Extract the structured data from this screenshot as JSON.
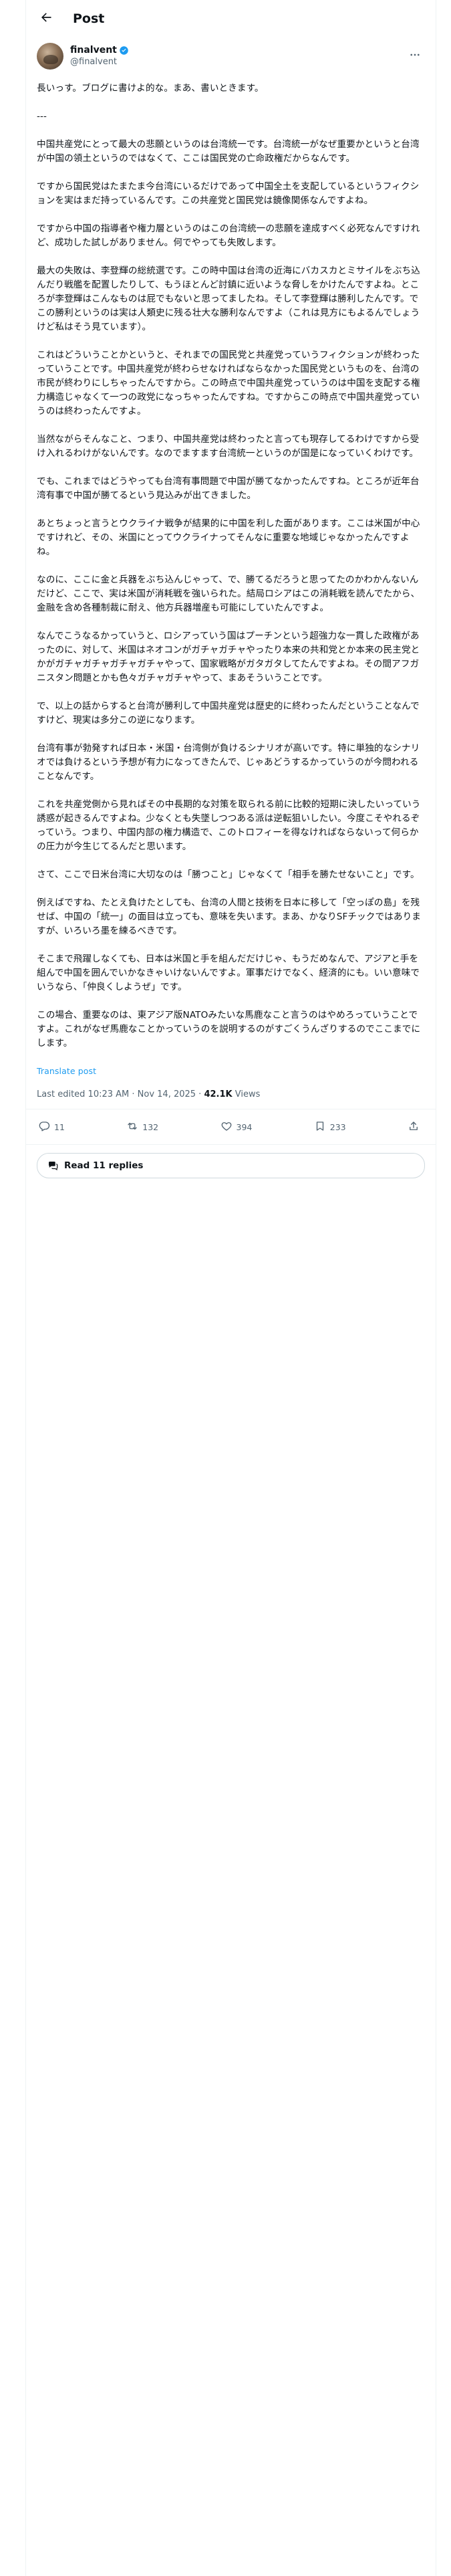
{
  "header": {
    "title": "Post"
  },
  "author": {
    "display_name": "finalvent",
    "handle": "@finalvent"
  },
  "post": {
    "paragraphs": [
      "長いっす。ブログに書けよ的な。まあ、書いときます。",
      "---",
      "中国共産党にとって最大の悲願というのは台湾統一です。台湾統一がなぜ重要かというと台湾が中国の領土というのではなくて、ここは国民党の亡命政権だからなんです。",
      "ですから国民党はたまたま今台湾にいるだけであって中国全土を支配しているというフィクションを実はまだ持っているんです。この共産党と国民党は鏡像関係なんですよね。",
      "ですから中国の指導者や権力層というのはこの台湾統一の悲願を達成すべく必死なんですけれど、成功した試しがありません。何でやっても失敗します。",
      "最大の失敗は、李登輝の総統選です。この時中国は台湾の近海にバカスカとミサイルをぶち込んだり戦艦を配置したりして、もうほとんど討鎮に近いような脅しをかけたんですよね。ところが李登輝はこんなものは屁でもないと思ってましたね。そして李登輝は勝利したんです。でこの勝利というのは実は人類史に残る壮大な勝利なんですよ（これは見方にもよるんでしょうけど私はそう見ています）。",
      "これはどういうことかというと、それまでの国民党と共産党っていうフィクションが終わったっていうことです。中国共産党が終わらせなければならなかった国民党というものを、台湾の市民が終わりにしちゃったんですから。この時点で中国共産党っていうのは中国を支配する権力構造じゃなくて一つの政党になっちゃったんですね。ですからこの時点で中国共産党っていうのは終わったんですよ。",
      "当然ながらそんなこと、つまり、中国共産党は終わったと言っても現存してるわけですから受け入れるわけがないんです。なのでますます台湾統一というのが国是になっていくわけです。",
      "でも、これまではどうやっても台湾有事問題で中国が勝てなかったんですね。ところが近年台湾有事で中国が勝てるという見込みが出てきました。",
      "あとちょっと言うとウクライナ戦争が結果的に中国を利した面があります。ここは米国が中心ですけれど、その、米国にとってウクライナってそんなに重要な地域じゃなかったんですよね。",
      "なのに、ここに金と兵器をぶち込んじゃって、で、勝てるだろうと思ってたのかわかんないんだけど、ここで、実は米国が消耗戦を強いられた。結局ロシアはこの消耗戦を読んでたから、金融を含め各種制裁に耐え、他方兵器増産も可能にしていたんですよ。",
      "なんでこうなるかっていうと、ロシアっていう国はプーチンという超強力な一貫した政権があったのに、対して、米国はネオコンがガチャガチャやったり本来の共和党とか本来の民主党とかがガチャガチャガチャガチャやって、国家戦略がガタガタしてたんですよね。その間アフガニスタン問題とかも色々ガチャガチャやって、まあそういうことです。",
      "で、以上の話からすると台湾が勝利して中国共産党は歴史的に終わったんだということなんですけど、現実は多分この逆になります。",
      "台湾有事が勃発すれば日本・米国・台湾側が負けるシナリオが高いです。特に単独的なシナリオでは負けるという予想が有力になってきたんで、じゃあどうするかっていうのが今問われることなんです。",
      "これを共産党側から見ればその中長期的な対策を取られる前に比較的短期に決したいっていう誘惑が起きるんですよね。少なくとも失墜しつつある派は逆転狙いしたい。今度こそやれるぞっていう。つまり、中国内部の権力構造で、このトロフィーを得なければならないって何らかの圧力が今生じてるんだと思います。",
      "さて、ここで日米台湾に大切なのは「勝つこと」じゃなくて「相手を勝たせないこと」です。",
      "例えばですね、たとえ負けたとしても、台湾の人間と技術を日本に移して「空っぽの島」を残せば、中国の「統一」の面目は立っても、意味を失います。まあ、かなりSFチックではありますが、いろいろ墨を練るべきです。",
      "そこまで飛躍しなくても、日本は米国と手を組んだだけじゃ、もうだめなんで、アジアと手を組んで中国を囲んでいかなきゃいけないんですよ。軍事だけでなく、経済的にも。いい意味でいうなら、「仲良くしようぜ」です。",
      "この場合、重要なのは、東アジア版NATOみたいな馬鹿なこと言うのはやめろっていうことですよ。これがなぜ馬鹿なことかっていうのを説明するのがすごくうんざりするのでここまでにします。"
    ],
    "translate_label": "Translate post",
    "last_edited": "Last edited 10:23 AM · Nov 14, 2025 · ",
    "views_count": "42.1K",
    "views_label": " Views"
  },
  "actions": {
    "replies": "11",
    "reposts": "132",
    "likes": "394",
    "bookmarks": "233"
  },
  "read_replies_label": "Read 11 replies",
  "icons": {
    "back": "arrow-left-icon",
    "verified": "verified-badge-icon",
    "more": "more-horizontal-icon",
    "reply": "comment-icon",
    "repost": "repost-icon",
    "like": "heart-icon",
    "bookmark": "bookmark-icon",
    "share": "share-icon",
    "read_replies": "speech-bubbles-icon"
  },
  "colors": {
    "accent": "#1d9bf0",
    "text": "#0f1419",
    "muted": "#536471",
    "border": "#eff3f4"
  }
}
